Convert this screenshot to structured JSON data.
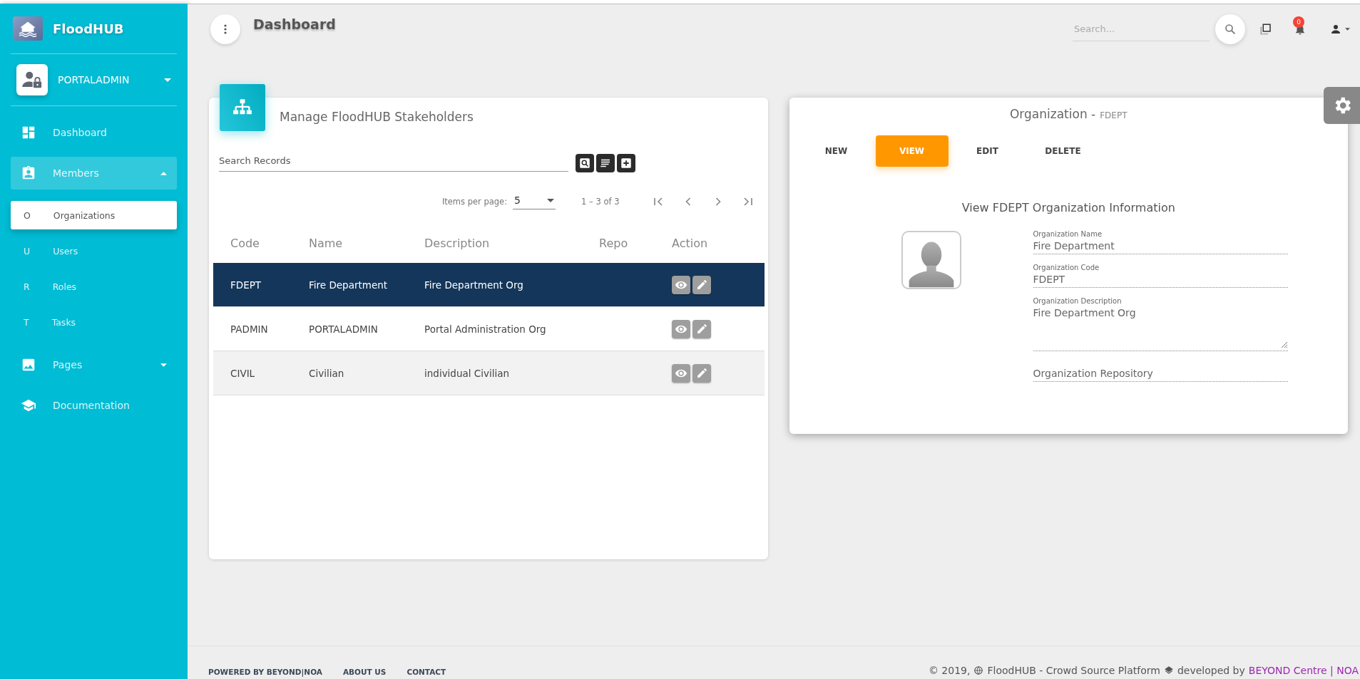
{
  "sidebar": {
    "brand": "FloodHUB",
    "user": {
      "name": "PORTALADMIN",
      "expanded": false
    },
    "items": [
      {
        "kind": "link",
        "label": "Dashboard",
        "selected": false
      },
      {
        "kind": "group",
        "label": "Members",
        "selected": true,
        "expanded": true,
        "children": [
          {
            "abbr": "O",
            "label": "Organizations",
            "selected": true
          },
          {
            "abbr": "U",
            "label": "Users",
            "selected": false
          },
          {
            "abbr": "R",
            "label": "Roles",
            "selected": false
          },
          {
            "abbr": "T",
            "label": "Tasks",
            "selected": false
          }
        ]
      },
      {
        "kind": "group",
        "label": "Pages",
        "selected": false,
        "expanded": false
      },
      {
        "kind": "link",
        "label": "Documentation",
        "selected": false
      }
    ]
  },
  "topbar": {
    "title": "Dashboard",
    "search": {
      "placeholder": "Search..."
    },
    "notifications": "0"
  },
  "stakeholders": {
    "title": "Manage FloodHUB Stakeholders",
    "search": {
      "placeholder": "Search Records"
    },
    "paginator": {
      "label": "Items per page:",
      "page_size": "5",
      "range": "1 – 3 of 3"
    },
    "columns": [
      "Code",
      "Name",
      "Description",
      "Repo",
      "Action"
    ],
    "rows": [
      {
        "code": "FDEPT",
        "name": "Fire Department",
        "description": "Fire Department Org",
        "selected": true
      },
      {
        "code": "PADMIN",
        "name": "PORTALADMIN",
        "description": "Portal Administration Org",
        "selected": false
      },
      {
        "code": "CIVIL",
        "name": "Civilian",
        "description": "individual Civilian",
        "selected": false
      }
    ]
  },
  "organization": {
    "title": "Organization -",
    "code": "FDEPT",
    "actions": [
      {
        "label": "NEW",
        "selected": false
      },
      {
        "label": "VIEW",
        "selected": true
      },
      {
        "label": "EDIT",
        "selected": false
      },
      {
        "label": "DELETE",
        "selected": false
      }
    ],
    "heading": "View FDEPT Organization Information",
    "fields": [
      {
        "kind": "text",
        "label": "Organization Name",
        "value": "Fire Department"
      },
      {
        "kind": "text",
        "label": "Organization Code",
        "value": "FDEPT"
      },
      {
        "kind": "textarea",
        "label": "Organization Description",
        "value": "Fire Department Org"
      },
      {
        "kind": "text",
        "placeholder": "Organization Repository"
      }
    ]
  },
  "footer": {
    "links": [
      "POWERED BY BEYOND|NOA",
      "ABOUT US",
      "CONTACT"
    ],
    "copyright": "© 2019,",
    "platform": "FloodHUB - Crowd Source Platform",
    "developed": "developed by",
    "credit_link": "BEYOND Centre | NOA"
  }
}
